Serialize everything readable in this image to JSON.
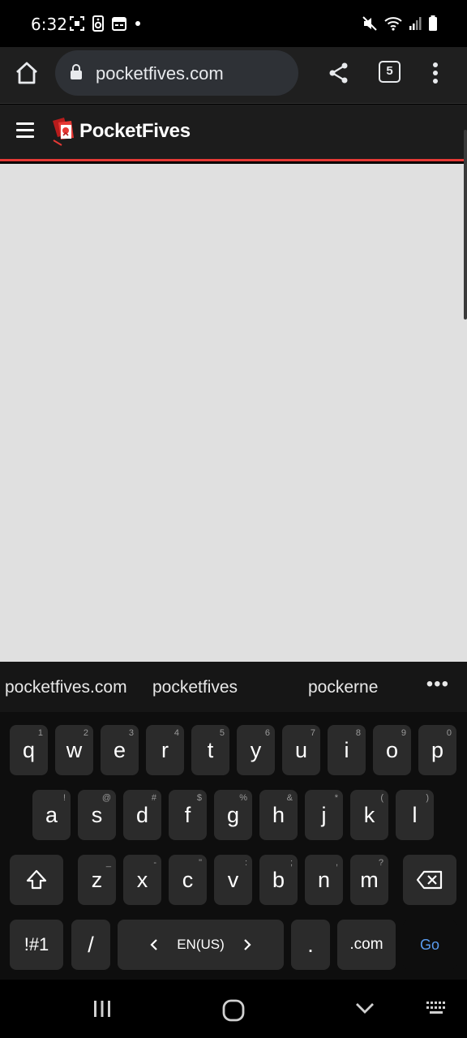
{
  "status_bar": {
    "time": "6:32",
    "left_icons": [
      "screenshot-icon",
      "sound-icon",
      "calendar-icon",
      "dot-icon"
    ],
    "right_icons": [
      "mute-icon",
      "wifi-icon",
      "signal-icon",
      "battery-icon"
    ]
  },
  "browser": {
    "url": "pocketfives.com",
    "tab_count": "5"
  },
  "site": {
    "logo_text": "PocketFives",
    "brand_color": "#e53935"
  },
  "suggestions": {
    "items": [
      "pocketfives.com",
      "pocketfives",
      "pockerne"
    ],
    "more_label": "•••"
  },
  "keyboard": {
    "row1": [
      {
        "key": "q",
        "hint": "1"
      },
      {
        "key": "w",
        "hint": "2"
      },
      {
        "key": "e",
        "hint": "3"
      },
      {
        "key": "r",
        "hint": "4"
      },
      {
        "key": "t",
        "hint": "5"
      },
      {
        "key": "y",
        "hint": "6"
      },
      {
        "key": "u",
        "hint": "7"
      },
      {
        "key": "i",
        "hint": "8"
      },
      {
        "key": "o",
        "hint": "9"
      },
      {
        "key": "p",
        "hint": "0"
      }
    ],
    "row2": [
      {
        "key": "a",
        "hint": "!"
      },
      {
        "key": "s",
        "hint": "@"
      },
      {
        "key": "d",
        "hint": "#"
      },
      {
        "key": "f",
        "hint": "$"
      },
      {
        "key": "g",
        "hint": "%"
      },
      {
        "key": "h",
        "hint": "&"
      },
      {
        "key": "j",
        "hint": "*"
      },
      {
        "key": "k",
        "hint": "("
      },
      {
        "key": "l",
        "hint": ")"
      }
    ],
    "row3": [
      {
        "key": "z",
        "hint": "_"
      },
      {
        "key": "x",
        "hint": "-"
      },
      {
        "key": "c",
        "hint": "\""
      },
      {
        "key": "v",
        "hint": ":"
      },
      {
        "key": "b",
        "hint": ";"
      },
      {
        "key": "n",
        "hint": ","
      },
      {
        "key": "m",
        "hint": "?"
      }
    ],
    "symbols_label": "!#1",
    "slash_label": "/",
    "language_label": "EN(US)",
    "period_label": ".",
    "dotcom_label": ".com",
    "go_label": "Go"
  }
}
